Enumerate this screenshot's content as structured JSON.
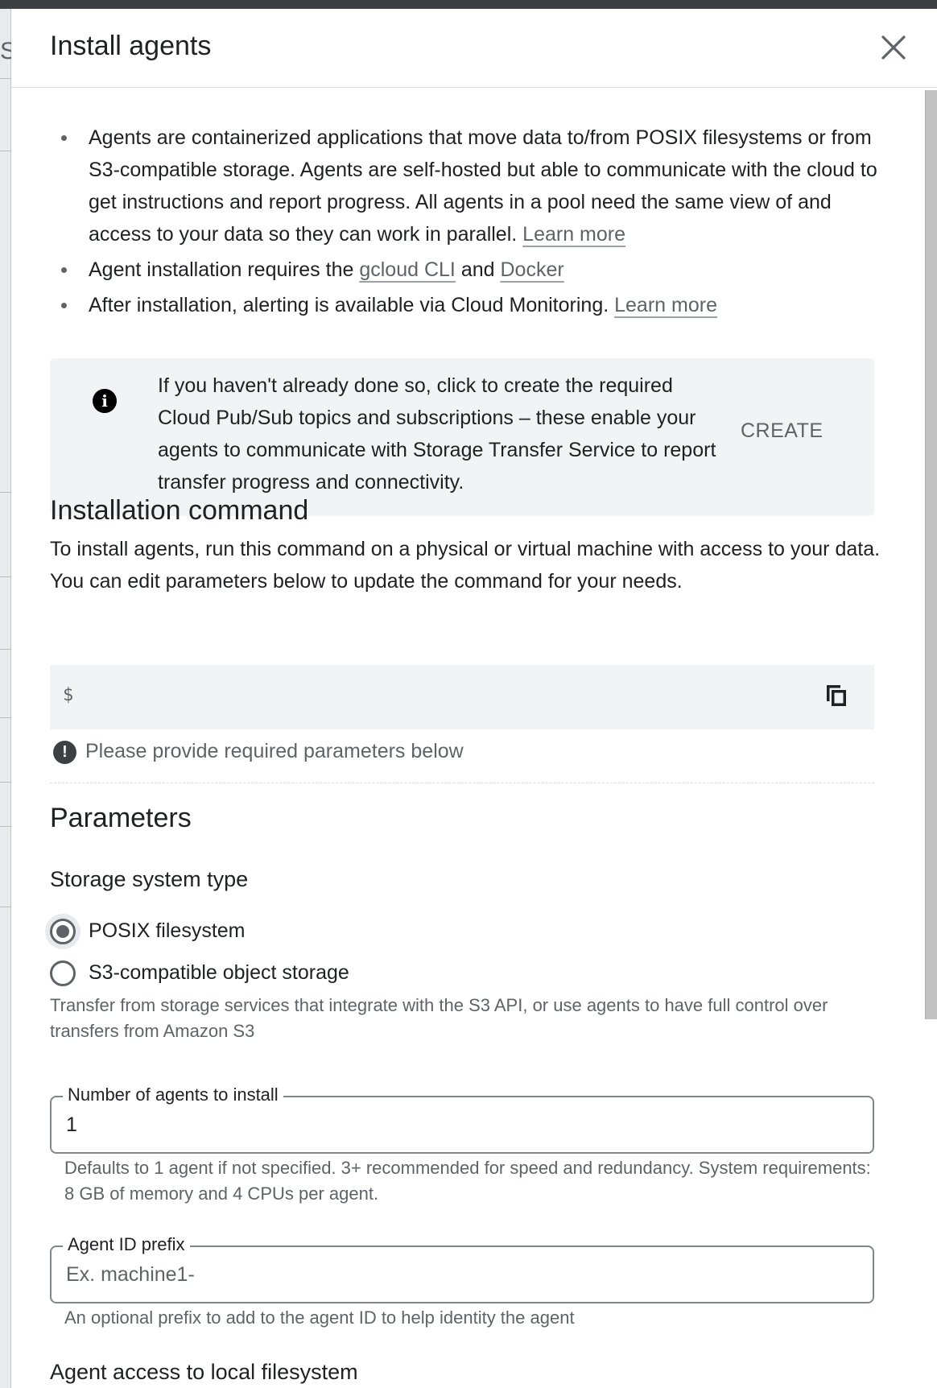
{
  "background_fragment": "Se",
  "dialog": {
    "title": "Install agents"
  },
  "intro": {
    "bullet1_text": "Agents are containerized applications that move data to/from POSIX filesystems or from S3-compatible storage. Agents are self-hosted but able to communicate with the cloud to get instructions and report progress. All agents in a pool need the same view of and access to your data so they can work in parallel.",
    "bullet1_link": "Learn more",
    "bullet2_text": "Agent installation requires the",
    "bullet2_link1": "gcloud CLI",
    "bullet2_and": "and",
    "bullet2_link2": "Docker",
    "bullet3_text": "After installation, alerting is available via Cloud Monitoring.",
    "bullet3_link": "Learn more"
  },
  "info_box": {
    "text": "If you haven't already done so, click to create the required Cloud Pub/Sub topics and subscriptions – these enable your agents to communicate with Storage Transfer Service to report transfer progress and connectivity.",
    "button": "CREATE"
  },
  "installation": {
    "title": "Installation command",
    "description": "To install agents, run this command on a physical or virtual machine with access to your data. You can edit parameters below to update the command for your needs.",
    "prompt": "$",
    "error": "Please provide required parameters below"
  },
  "parameters": {
    "title": "Parameters",
    "storage_type_title": "Storage system type",
    "option_posix": "POSIX filesystem",
    "option_s3": "S3-compatible object storage",
    "s3_hint": "Transfer from storage services that integrate with the S3 API, or use agents to have full control over transfers from Amazon S3",
    "agents_count_label": "Number of agents to install",
    "agents_count_value": "1",
    "agents_count_hint": "Defaults to 1 agent if not specified. 3+ recommended for speed and redundancy. System requirements: 8 GB of memory and 4 CPUs per agent.",
    "agent_prefix_label": "Agent ID prefix",
    "agent_prefix_placeholder": "Ex. machine1-",
    "agent_prefix_hint": "An optional prefix to add to the agent ID to help identity the agent",
    "local_fs_title": "Agent access to local filesystem"
  }
}
